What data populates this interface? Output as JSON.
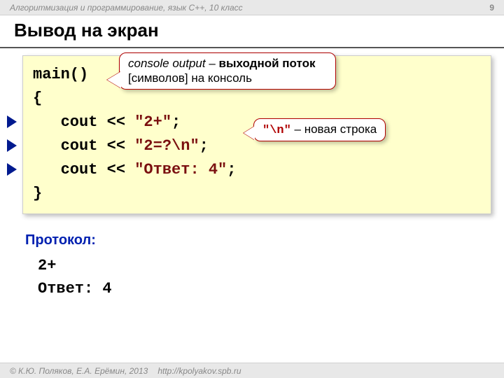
{
  "header": {
    "subject": "Алгоритмизация и программирование, язык  C++, 10 класс",
    "page": "9"
  },
  "title": "Вывод на экран",
  "code": {
    "l1": "main()",
    "l2": "{",
    "l3_indent": "   ",
    "l3_cout": "cout",
    "l3_op": " << ",
    "l3_str": "\"2+\"",
    "l3_semi": ";",
    "l4_indent": "   ",
    "l4_cout": "cout",
    "l4_op": " << ",
    "l4_str": "\"2=?\\n\"",
    "l4_semi": ";",
    "l5_indent": "   ",
    "l5_cout": "cout",
    "l5_op": " << ",
    "l5_str": "\"Ответ: 4\"",
    "l5_semi": ";",
    "l6": "}"
  },
  "callout1": {
    "part1": "console output",
    "part2": " – ",
    "part3": "выходной поток",
    "part4": " [символов] на консоль"
  },
  "callout2": {
    "nl": "\"\\n\"",
    "rest": " – новая строка"
  },
  "protocol": {
    "label": "Протокол:",
    "out1": "2+",
    "out2": "Ответ: 4"
  },
  "footer": {
    "copyright": "© К.Ю. Поляков, Е.А. Ерёмин, 2013",
    "url": "http://kpolyakov.spb.ru"
  }
}
